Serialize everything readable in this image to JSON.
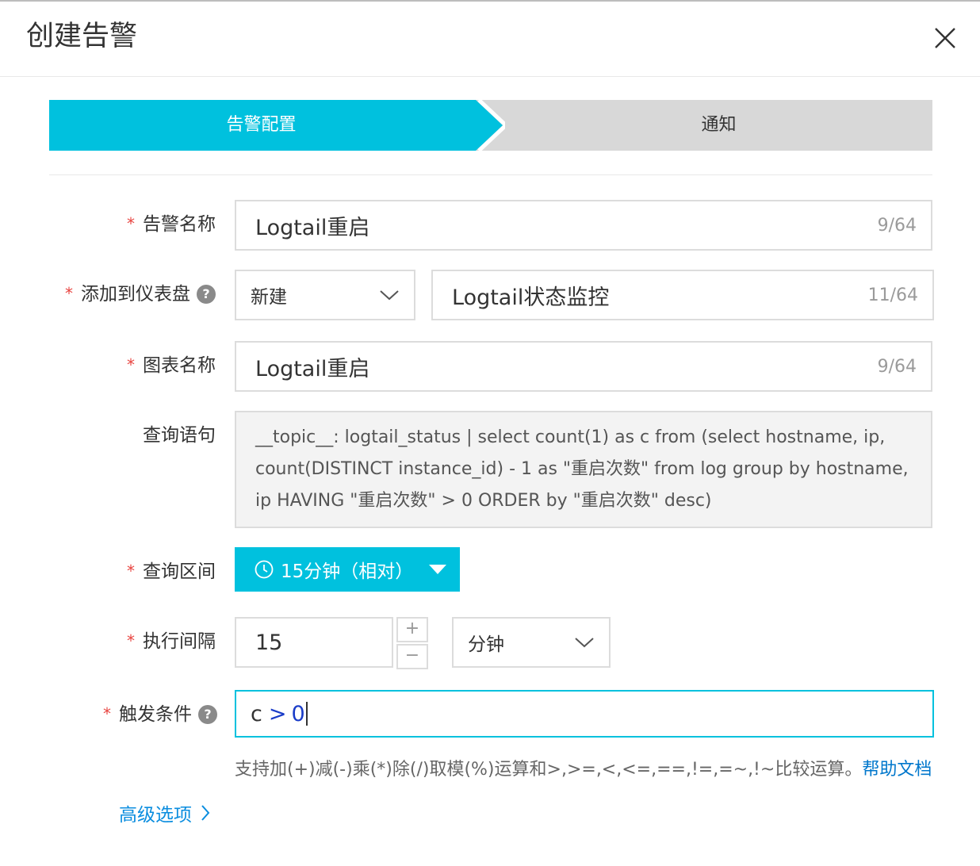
{
  "dialog": {
    "title": "创建告警"
  },
  "steps": [
    {
      "label": "告警配置",
      "active": true
    },
    {
      "label": "通知",
      "active": false
    }
  ],
  "form": {
    "alert_name": {
      "label": "告警名称",
      "value": "Logtail重启",
      "count": "9/64"
    },
    "dashboard": {
      "label": "添加到仪表盘",
      "mode": "新建",
      "value": "Logtail状态监控",
      "count": "11/64"
    },
    "chart_name": {
      "label": "图表名称",
      "value": "Logtail重启",
      "count": "9/64"
    },
    "query": {
      "label": "查询语句",
      "value": "__topic__: logtail_status | select count(1) as c from (select hostname, ip, count(DISTINCT instance_id) - 1 as \"重启次数\" from log group by hostname, ip HAVING \"重启次数\" > 0 ORDER by \"重启次数\" desc)"
    },
    "time_range": {
      "label": "查询区间",
      "value": "15分钟（相对）"
    },
    "interval": {
      "label": "执行间隔",
      "value": "15",
      "unit": "分钟",
      "plus": "+",
      "minus": "−"
    },
    "trigger": {
      "label": "触发条件",
      "c": "c",
      "op": ">",
      "num": "0",
      "hint": "支持加(+)减(-)乘(*)除(/)取模(%)运算和>,>=,<,<=,==,!=,=~,!~比较运算。",
      "help_link": "帮助文档"
    },
    "required_mark": "*",
    "help_mark": "?"
  },
  "advanced": {
    "label": "高级选项"
  },
  "colors": {
    "accent": "#00c1de",
    "required": "#e8433f",
    "link": "#0077cc"
  },
  "icons": [
    "close-icon",
    "chevron-down-icon",
    "question-icon",
    "clock-icon",
    "caret-down-icon",
    "chevron-right-icon"
  ]
}
